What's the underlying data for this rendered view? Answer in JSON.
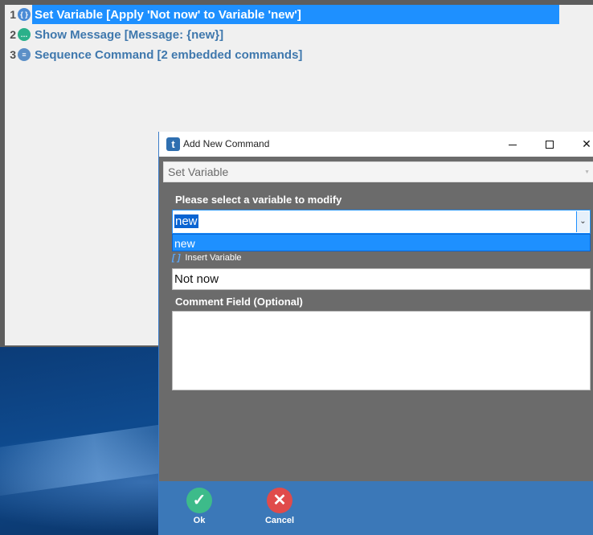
{
  "editor": {
    "commands": [
      {
        "number": "1",
        "icon": "set-variable-icon",
        "icon_glyph": "{ }",
        "icon_color": "#4a8bd6",
        "label": "Set Variable [Apply 'Not now' to Variable 'new']",
        "selected": true
      },
      {
        "number": "2",
        "icon": "show-message-icon",
        "icon_glyph": "…",
        "icon_color": "#2ab08a",
        "label": "Show Message [Message: {new}]",
        "selected": false
      },
      {
        "number": "3",
        "icon": "sequence-command-icon",
        "icon_glyph": "≡",
        "icon_color": "#5b8fc7",
        "label": "Sequence Command [2 embedded commands]",
        "selected": false
      }
    ]
  },
  "dialog": {
    "title": "Add New Command",
    "title_icon": "t",
    "command_type": "Set Variable",
    "variable_label": "Please select a variable to modify",
    "variable_value": "new",
    "variable_options": [
      "new"
    ],
    "insert_variable_label": "Insert Variable",
    "value_input": "Not now",
    "comment_label": "Comment Field (Optional)",
    "comment_value": "",
    "ok_label": "Ok",
    "cancel_label": "Cancel"
  },
  "colors": {
    "selection": "#1e90ff",
    "command_text": "#3f78ad",
    "ok": "#3dbb8a",
    "cancel": "#e04b4b",
    "footer": "#3b78b8"
  }
}
